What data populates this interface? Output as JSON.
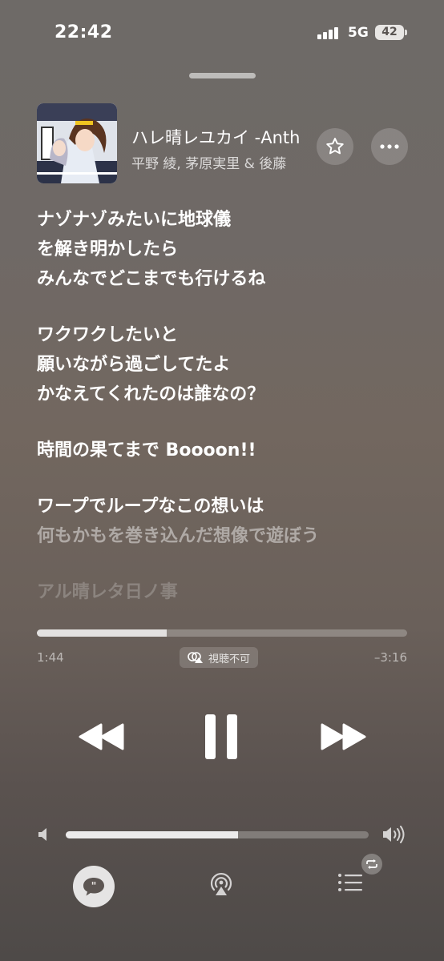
{
  "status_bar": {
    "time": "22:42",
    "network": "5G",
    "battery": "42"
  },
  "track": {
    "title": "ハレ晴レユカイ -Anth",
    "artist": "平野 綾, 茅原実里 & 後藤"
  },
  "lyrics": {
    "stanzas": [
      [
        "ナゾナゾみたいに地球儀",
        "を解き明かしたら",
        "みんなでどこまでも行けるね"
      ],
      [
        "ワクワクしたいと",
        "願いながら過ごしてたよ",
        "かなえてくれたのは誰なの？"
      ],
      [
        "時間の果てまで Boooon!!"
      ],
      [
        "ワープでループなこの想いは",
        "何もかもを巻き込んだ想像で遊ぼう"
      ],
      [
        "アル晴レタ日ノ事"
      ]
    ]
  },
  "playback": {
    "elapsed": "1:44",
    "remaining": "–3:16",
    "progress": 0.35,
    "badge": "視聴不可"
  },
  "volume": {
    "level": 0.57
  },
  "icons": {
    "star": "star-icon",
    "more": "more-icon",
    "rewind": "rewind-icon",
    "pause": "pause-icon",
    "forward": "fast-forward-icon",
    "lyrics": "lyrics-quote-icon",
    "airplay": "airplay-icon",
    "queue": "queue-list-icon",
    "repeat": "repeat-icon"
  }
}
